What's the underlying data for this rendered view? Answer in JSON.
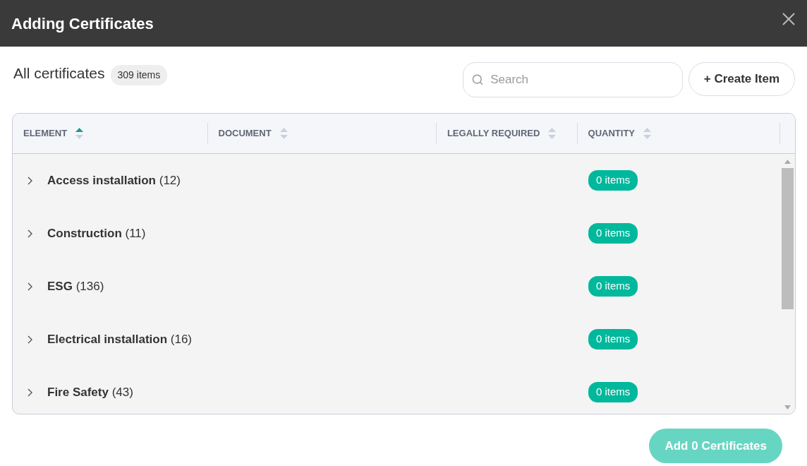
{
  "window": {
    "title": "Adding Certificates"
  },
  "toolbar": {
    "heading": "All certificates",
    "count": "309 items",
    "search": {
      "placeholder": "Search"
    },
    "create_button": "+ Create Item"
  },
  "table": {
    "columns": [
      {
        "label": "ELEMENT",
        "sorted": true
      },
      {
        "label": "DOCUMENT",
        "sorted": false
      },
      {
        "label": "LEGALLY REQUIRED",
        "sorted": false
      },
      {
        "label": "QUANTITY",
        "sorted": false
      }
    ],
    "rows": [
      {
        "element": "**Access installation** (12)",
        "expanded": false,
        "quantity": "0 items"
      },
      {
        "element": "**Construction** (11)",
        "expanded": false,
        "quantity": "0 items"
      },
      {
        "element": "**ESG** (136)",
        "expanded": false,
        "quantity": "0 items"
      },
      {
        "element": "**Electrical installation** (16)",
        "expanded": false,
        "quantity": "0 items"
      },
      {
        "element": "**Fire Safety** (43)",
        "expanded": false,
        "quantity": "0 items"
      }
    ]
  },
  "footer": {
    "add_button": {
      "label": "Add 0 Certificates",
      "disabled": true
    }
  }
}
